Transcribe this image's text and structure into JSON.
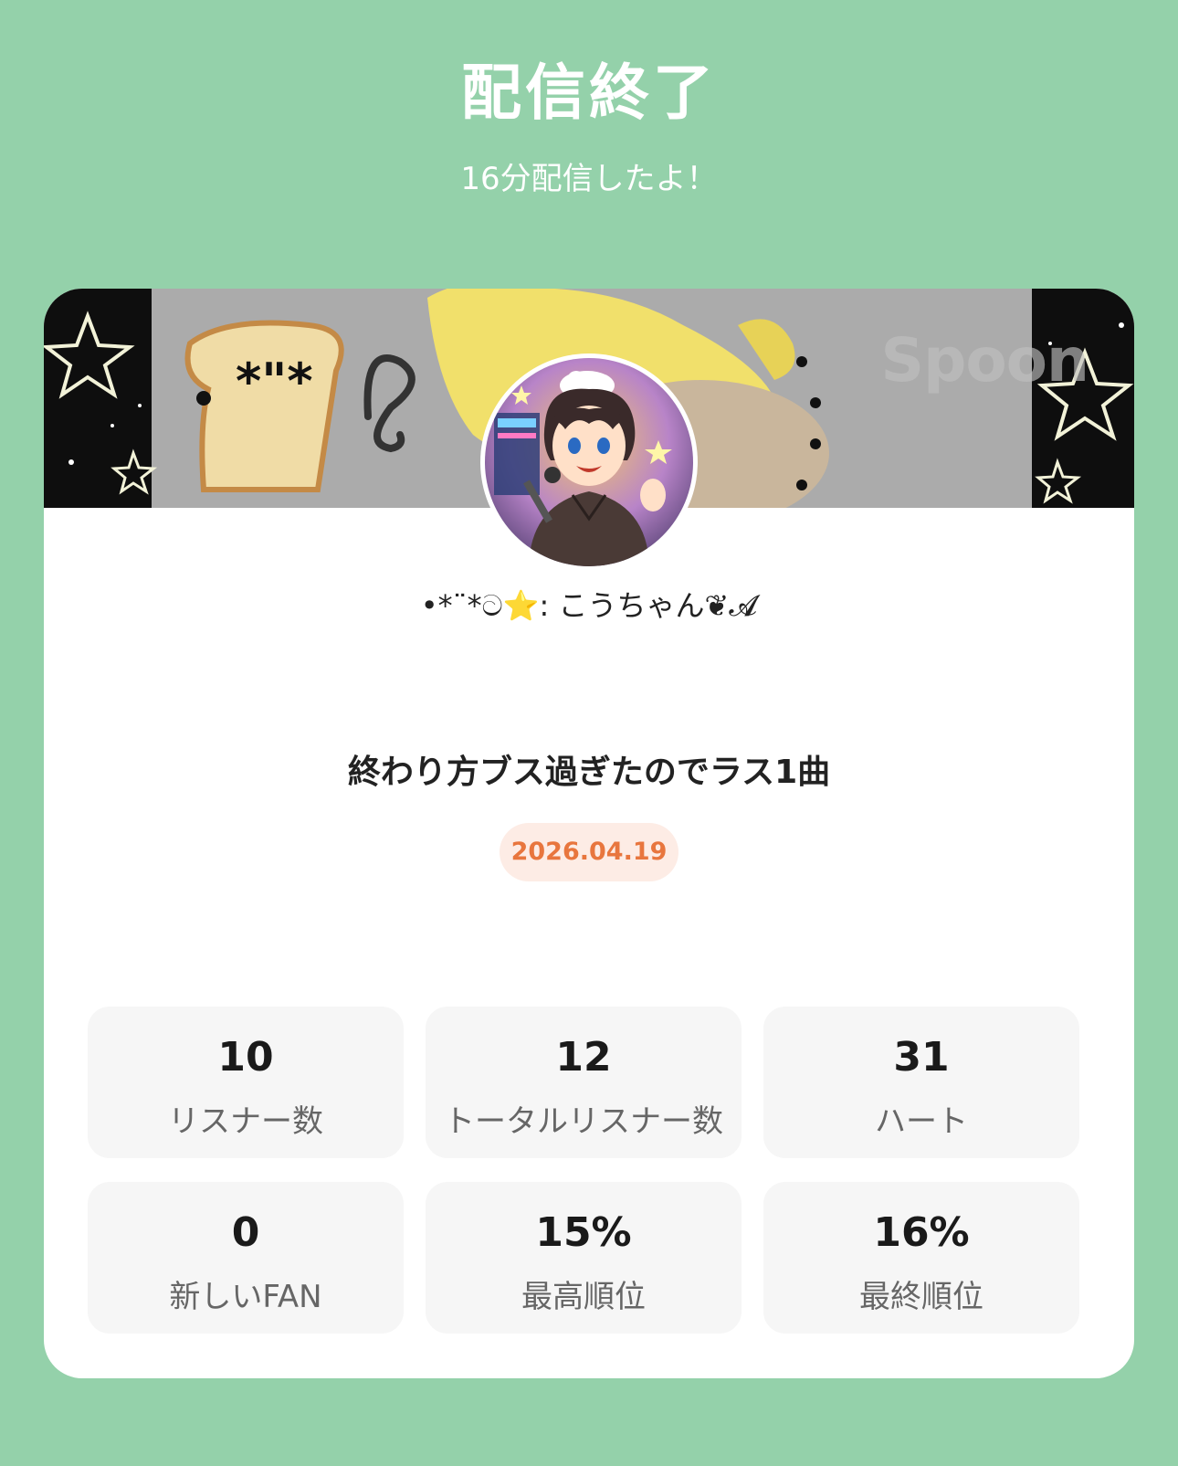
{
  "header": {
    "title": "配信終了",
    "subtitle": "16分配信したよ！"
  },
  "card": {
    "banner_watermark": "Spoon",
    "username": "•*¨*ට⭐️: こうちゃん❦𝓐",
    "stream_title": "終わり方ブス過ぎたのでラス1曲",
    "date": "2026.04.19"
  },
  "stats": [
    {
      "value": "10",
      "label": "リスナー数"
    },
    {
      "value": "12",
      "label": "トータルリスナー数"
    },
    {
      "value": "31",
      "label": "ハート"
    },
    {
      "value": "0",
      "label": "新しいFAN"
    },
    {
      "value": "15%",
      "label": "最高順位"
    },
    {
      "value": "16%",
      "label": "最終順位"
    }
  ],
  "colors": {
    "background": "#94d1aa",
    "card": "#ffffff",
    "date_text": "#e8763e",
    "date_bg": "#fdece5",
    "stat_bg": "#f6f6f6"
  }
}
